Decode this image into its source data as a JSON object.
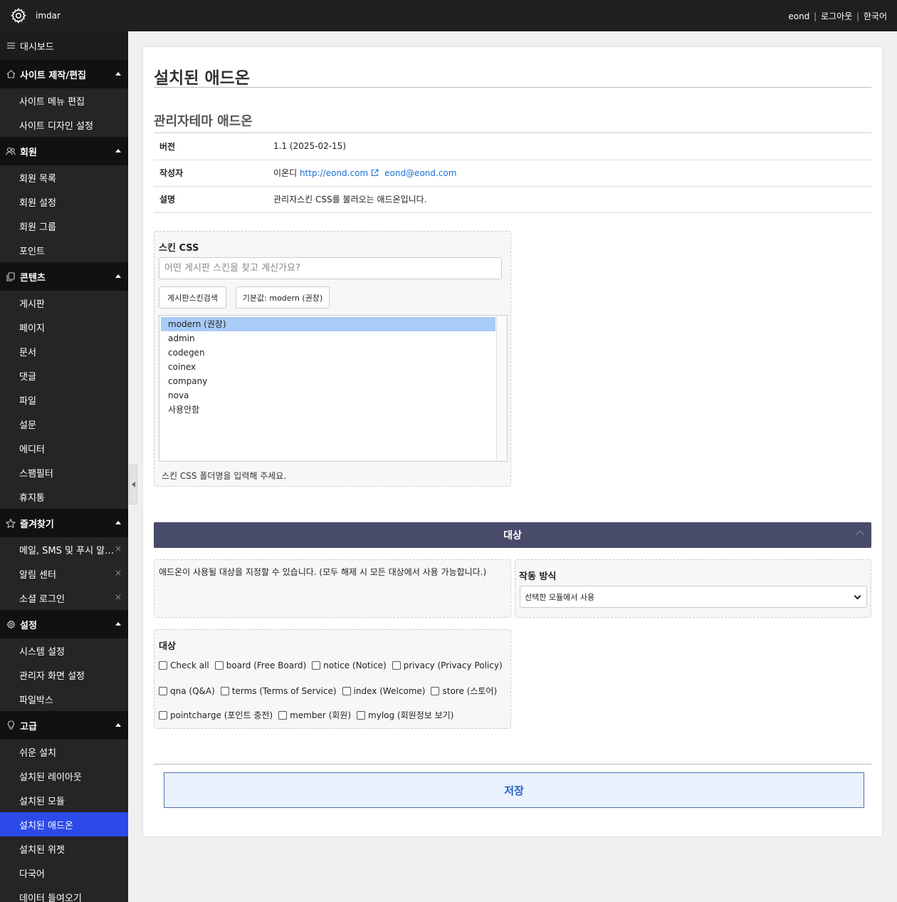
{
  "topbar": {
    "brand": "imdar",
    "user": "eond",
    "logout": "로그아웃",
    "language": "한국어",
    "separator": "|"
  },
  "sidebar": {
    "dashboard": "대시보드",
    "groups": [
      {
        "label": "사이트 제작/편집",
        "icon": "home-icon",
        "items": [
          "사이트 메뉴 편집",
          "사이트 디자인 설정"
        ]
      },
      {
        "label": "회원",
        "icon": "users-icon",
        "items": [
          "회원 목록",
          "회원 설정",
          "회원 그룹",
          "포인트"
        ]
      },
      {
        "label": "콘텐츠",
        "icon": "copy-icon",
        "items": [
          "게시판",
          "페이지",
          "문서",
          "댓글",
          "파일",
          "설문",
          "에디터",
          "스팸필터",
          "휴지통"
        ]
      },
      {
        "label": "즐겨찾기",
        "icon": "star-icon",
        "items": [
          "메일, SMS 및 푸시 알…",
          "알림 센터",
          "소셜 로그인"
        ]
      },
      {
        "label": "설정",
        "icon": "gear-icon",
        "items": [
          "시스템 설정",
          "관리자 화면 설정",
          "파일박스"
        ]
      },
      {
        "label": "고급",
        "icon": "bulb-icon",
        "items": [
          "쉬운 설치",
          "설치된 레이아웃",
          "설치된 모듈",
          "설치된 애드온",
          "설치된 위젯",
          "다국어",
          "데이터 들여오기"
        ]
      }
    ],
    "active_item": "설치된 애드온",
    "remove_symbol": "×"
  },
  "page": {
    "title": "설치된 애드온",
    "addon_name": "관리자테마 애드온",
    "info": {
      "version_label": "버전",
      "version_value": "1.1 (2025-02-15)",
      "author_label": "작성자",
      "author_name": "이온디",
      "author_url": "http://eond.com",
      "author_email": "eond@eond.com",
      "desc_label": "설명",
      "desc_value": "관리자스킨 CSS를 불러오는 애드온입니다."
    },
    "skin": {
      "label": "스킨 CSS",
      "search_placeholder": "어떤 게시판 스킨을 찾고 계신가요?",
      "search_button": "게시판스킨검색",
      "default_button": "기본값: modern (권장)",
      "options": [
        "modern (권장)",
        "admin",
        "codegen",
        "coinex",
        "company",
        "nova",
        "사용안함"
      ],
      "selected": "modern (권장)",
      "help": "스킨 CSS 폴더명을 입력해 주세요."
    },
    "target_section": {
      "title": "대상",
      "description": "애드온이 사용될 대상을 지정할 수 있습니다. (모두 해제 시 모든 대상에서 사용 가능합니다.)",
      "mode_label": "작동 방식",
      "mode_value": "선택한 모듈에서 사용",
      "targets_label": "대상",
      "checkbox_rows": [
        [
          "Check all",
          "board (Free Board)",
          "notice (Notice)",
          "privacy (Privacy Policy)"
        ],
        [
          "qna (Q&A)",
          "terms (Terms of Service)",
          "index (Welcome)",
          "store (스토어)"
        ],
        [
          "pointcharge (포인트 충전)",
          "member (회원)",
          "mylog (회원정보 보기)"
        ]
      ]
    },
    "save_button": "저장"
  }
}
